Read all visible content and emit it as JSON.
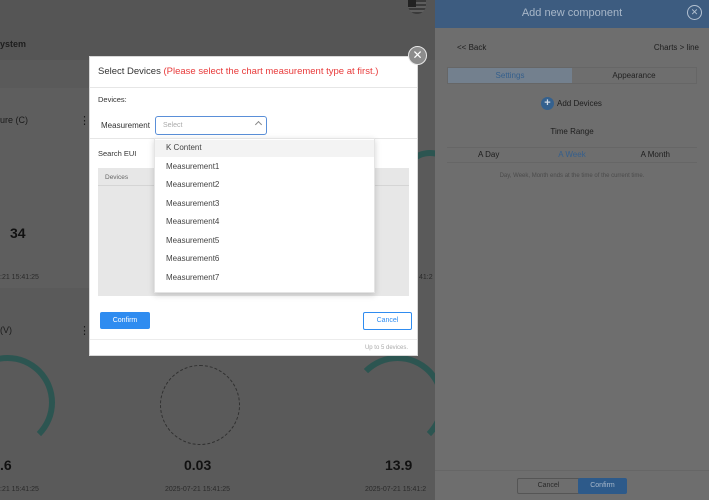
{
  "dashboard": {
    "system_label": "ystem",
    "card_left_top_label": "ure (C)",
    "card_left_top_value": "34",
    "card_left_top_time": ":21 15:41:25",
    "card_right_top_time": "41:2",
    "card_left_bottom_label": "(V)",
    "card_left_bottom_value": ".6",
    "card_mid_bottom_value": "0.03",
    "card_right_bottom_value": "13.9",
    "card_left_bottom_time": ":21 15:41:25",
    "card_mid_bottom_time": "2025-07-21 15:41:25",
    "card_right_bottom_time": "2025-07-21 15:41:2"
  },
  "panel": {
    "title": "Add new component",
    "back_label": "<< Back",
    "breadcrumb": "Charts > line",
    "tabs": [
      {
        "label": "Settings",
        "active": true
      },
      {
        "label": "Appearance",
        "active": false
      }
    ],
    "add_devices_label": "Add Devices",
    "time_range_label": "Time Range",
    "ranges": [
      {
        "label": "A Day",
        "active": false
      },
      {
        "label": "A Week",
        "active": true
      },
      {
        "label": "A Month",
        "active": false
      }
    ],
    "range_note": "Day, Week, Month ends at the time of the current time.",
    "cancel_label": "Cancel",
    "confirm_label": "Confirm"
  },
  "modal": {
    "title": "Select Devices",
    "warning": "(Please select the chart measurement type at first.)",
    "devices_label": "Devices:",
    "measurement_label": "Measurement",
    "select_placeholder": "Select",
    "search_label": "Search EUI",
    "table_header": "Devices",
    "confirm_label": "Confirm",
    "cancel_label": "Cancel",
    "limit_note": "Up to 5 devices."
  },
  "dropdown": {
    "options": [
      "K Content",
      "Measurement1",
      "Measurement2",
      "Measurement3",
      "Measurement4",
      "Measurement5",
      "Measurement6",
      "Measurement7"
    ],
    "highlighted_index": 0
  },
  "colors": {
    "accent": "#2f8cf0",
    "warning": "#e83a3a",
    "panel_header": "#3d5c80"
  }
}
